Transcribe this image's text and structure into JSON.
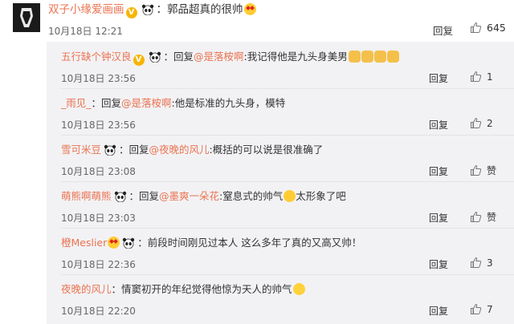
{
  "top_comment": {
    "username": "双子小缘爱画画",
    "separator": "：",
    "text": "郭品超真的很帅",
    "time": "10月18日 12:21",
    "reply_label": "回复",
    "likes": "645"
  },
  "replies": [
    {
      "username": "五行缺个钟汉良",
      "reply_prefix": "：回复",
      "target": "@是落桉啊",
      "text": ":我记得他是九头身美男",
      "time": "10月18日 23:56",
      "reply_label": "回复",
      "likes": "1"
    },
    {
      "username": "_雨见_",
      "reply_prefix": "：回复",
      "target": "@是落桉啊",
      "text": ":他是标准的九头身，模特",
      "time": "10月18日 23:56",
      "reply_label": "回复",
      "likes": "2"
    },
    {
      "username": "雪可米豆",
      "reply_prefix": "：回复",
      "target": "@夜晚的风儿",
      "text": ":概括的可以说是很准确了",
      "time": "10月18日 23:08",
      "reply_label": "回复",
      "likes": "赞"
    },
    {
      "username": "萌熊啊萌熊",
      "reply_prefix": "：回复",
      "target": "@墨爽一朵花",
      "text": ":窒息式的帅气",
      "text_after": "太形象了吧",
      "time": "10月18日 23:03",
      "reply_label": "回复",
      "likes": "赞"
    },
    {
      "username": "橙Meslier",
      "reply_prefix": "：",
      "target": "",
      "text": "前段时间刚见过本人 这么多年了真的又高又帅！",
      "time": "10月18日 22:36",
      "reply_label": "回复",
      "likes": "3"
    },
    {
      "username": "夜晚的风儿",
      "reply_prefix": "：",
      "target": "",
      "text": "情窦初开的年纪觉得他惊为天人的帅气",
      "time": "10月18日 22:20",
      "reply_label": "回复",
      "likes": "7"
    }
  ],
  "colors": {
    "link": "#eb7350",
    "panel_bg": "#f2f2f5",
    "badge": "#f7b500"
  },
  "icons": [
    "avatar",
    "verified-badge",
    "panda-emoji",
    "heart-eyes-emoji",
    "cat-emoji",
    "crying-emoji",
    "smile-emoji",
    "thumb-up-icon"
  ]
}
